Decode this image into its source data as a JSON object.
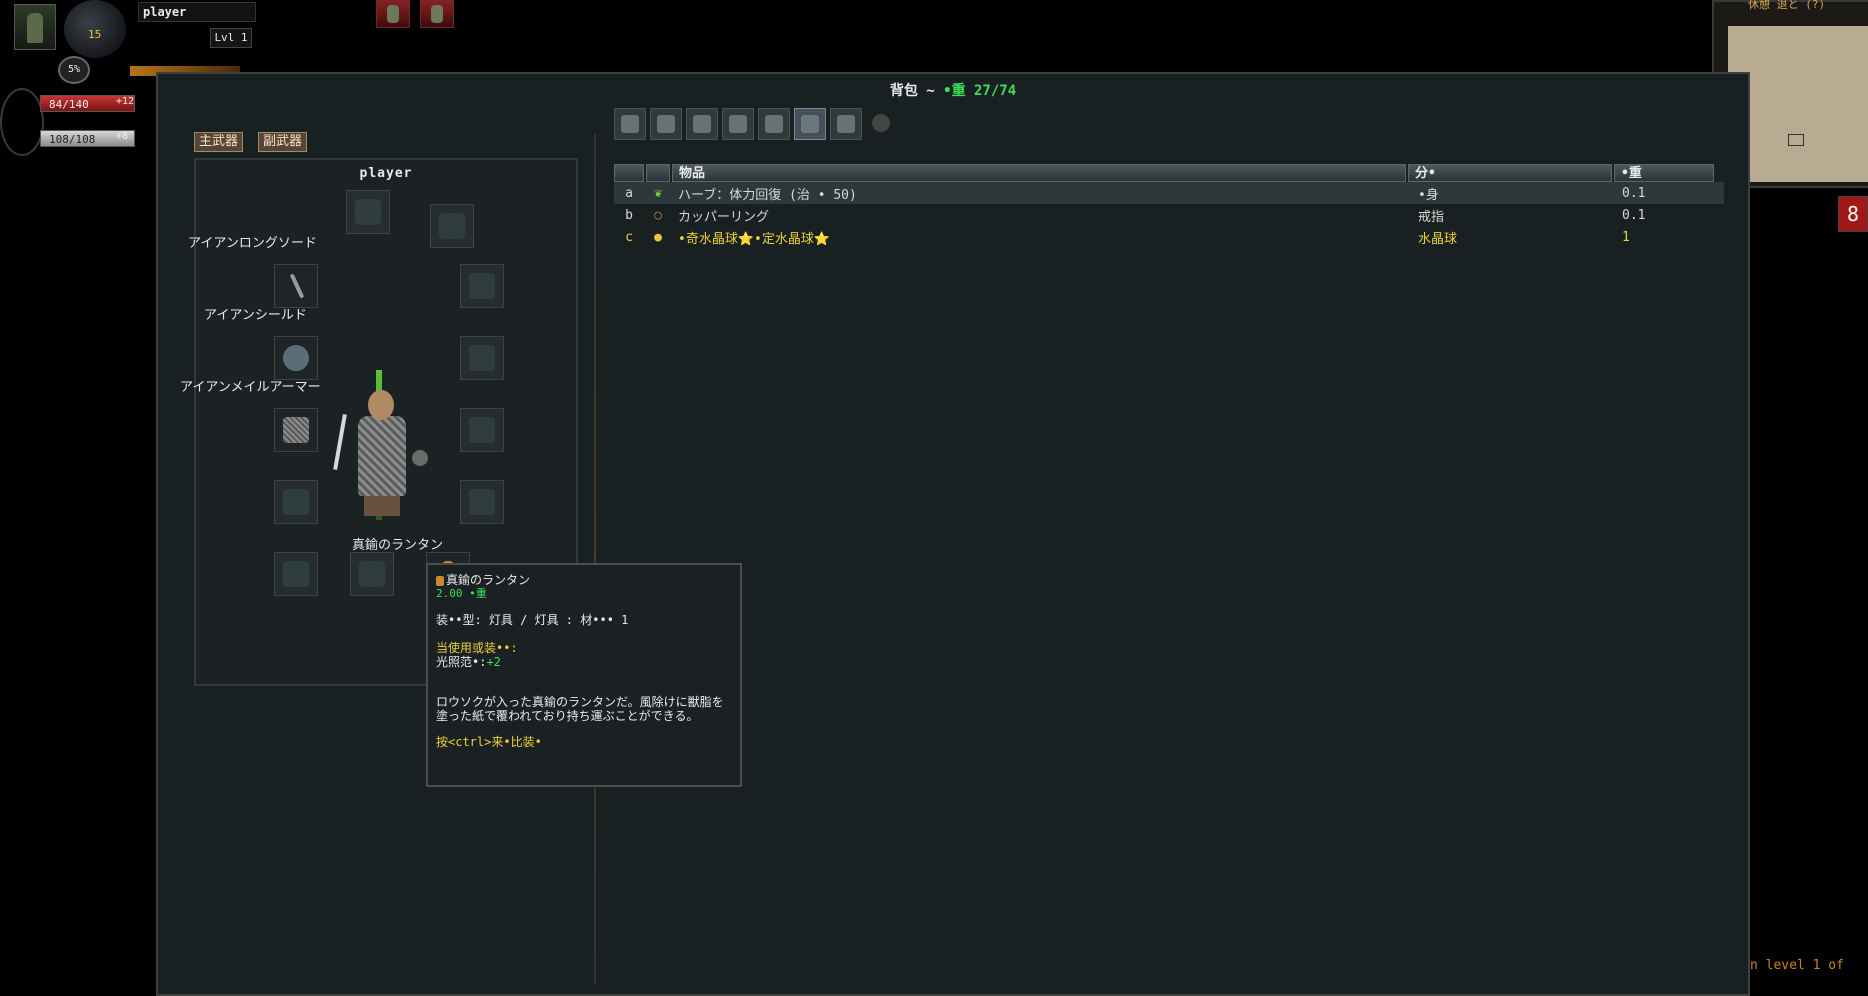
{
  "hud": {
    "player_name": "player",
    "gold": "15",
    "level": "Lvl 1",
    "xp_percent": "5%",
    "hp": "84/140",
    "hp_bonus": "+12",
    "mp": "108/108",
    "mp_bonus": "+8",
    "accent_hp": "#c63535",
    "accent_gold": "#e7c83a"
  },
  "minimap": {
    "label": "休憩  退と (?)",
    "side_badge": "8"
  },
  "window": {
    "title_prefix": "背包 ~ ",
    "title_weight": "•重 27/74"
  },
  "equipment": {
    "tabs": [
      "主武器",
      "副武器"
    ],
    "character_name": "player",
    "labels": {
      "weapon": "アイアンロングソード",
      "shield": "アイアンシールド",
      "armor": "アイアンメイルアーマー",
      "light": "真鍮のランタン"
    }
  },
  "filters": [
    {
      "icon": "sword-icon",
      "active": false
    },
    {
      "icon": "armor-icon",
      "active": false
    },
    {
      "icon": "bow-icon",
      "active": false
    },
    {
      "icon": "wand-icon",
      "active": false
    },
    {
      "icon": "ring-icon",
      "active": false
    },
    {
      "icon": "staff-icon",
      "active": true
    },
    {
      "icon": "chalice-icon",
      "active": false
    },
    {
      "icon": "bag-icon",
      "active": false
    }
  ],
  "inventory": {
    "columns": [
      "物品",
      "分•",
      "•重"
    ],
    "rows": [
      {
        "letter": "a",
        "icon": "herb-icon",
        "name": "ハーブ：体力回復 (治 • 50)",
        "type": "•身",
        "weight": "0.1"
      },
      {
        "letter": "b",
        "icon": "ring-icon",
        "name": "カッパーリング",
        "type": "戒指",
        "weight": "0.1"
      },
      {
        "letter": "c",
        "icon": "orb-icon",
        "name": "•奇水晶球⭐•定水晶球⭐",
        "type": "水晶球",
        "weight": "1"
      }
    ]
  },
  "tooltip": {
    "name": "真鍮のランタン",
    "weight": "2.00 •重",
    "type_line": "装••型: 灯具 / 灯具 : 材••• 1",
    "header": "当使用或装••:",
    "stat_label": "光照范•:",
    "stat_value": "+2",
    "description": "ロウソクが入った真鍮のランタンだ。風除けに獣脂を塗った紙で覆われており持ち運ぶことができる。",
    "hint": "按<ctrl>来•比装•"
  },
  "footer": {
    "level_message": "n level 1 of"
  }
}
